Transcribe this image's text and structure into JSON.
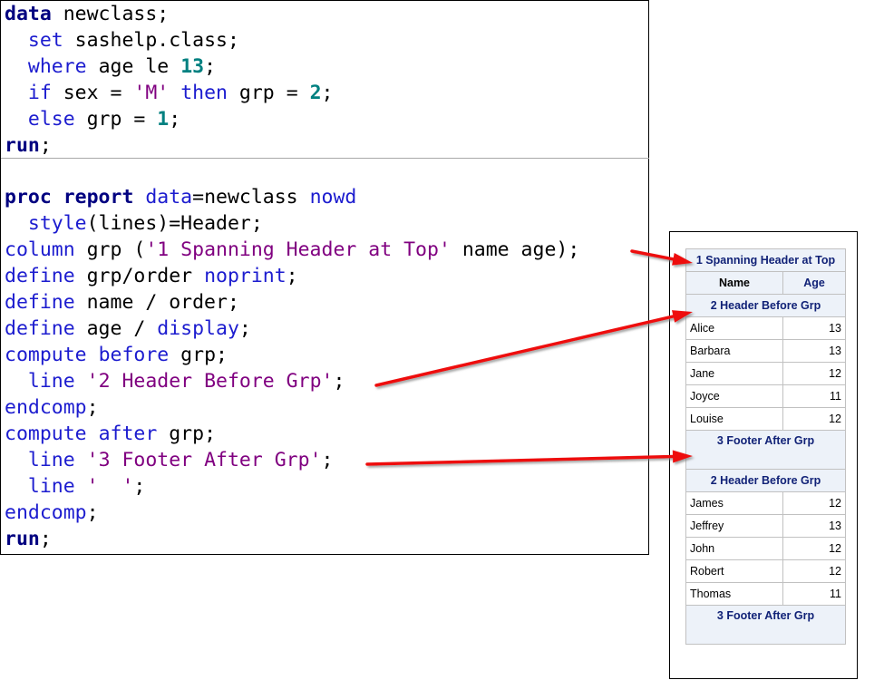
{
  "code": {
    "data_step": [
      [
        {
          "t": "data",
          "c": "kw-b"
        },
        {
          "t": " newclass;",
          "c": "plain"
        }
      ],
      [
        {
          "t": "  ",
          "c": "plain"
        },
        {
          "t": "set",
          "c": "kw-t"
        },
        {
          "t": " sashelp.class;",
          "c": "plain"
        }
      ],
      [
        {
          "t": "  ",
          "c": "plain"
        },
        {
          "t": "where",
          "c": "kw-t"
        },
        {
          "t": " age le ",
          "c": "plain"
        },
        {
          "t": "13",
          "c": "num"
        },
        {
          "t": ";",
          "c": "plain"
        }
      ],
      [
        {
          "t": "  ",
          "c": "plain"
        },
        {
          "t": "if",
          "c": "kw-t"
        },
        {
          "t": " sex = ",
          "c": "plain"
        },
        {
          "t": "'M'",
          "c": "str"
        },
        {
          "t": " ",
          "c": "plain"
        },
        {
          "t": "then",
          "c": "kw-t"
        },
        {
          "t": " grp = ",
          "c": "plain"
        },
        {
          "t": "2",
          "c": "num"
        },
        {
          "t": ";",
          "c": "plain"
        }
      ],
      [
        {
          "t": "  ",
          "c": "plain"
        },
        {
          "t": "else",
          "c": "kw-t"
        },
        {
          "t": " grp = ",
          "c": "plain"
        },
        {
          "t": "1",
          "c": "num"
        },
        {
          "t": ";",
          "c": "plain"
        }
      ],
      [
        {
          "t": "run",
          "c": "kw-b"
        },
        {
          "t": ";",
          "c": "plain"
        }
      ]
    ],
    "proc_step": [
      [
        {
          "t": "proc report",
          "c": "kw-b"
        },
        {
          "t": " ",
          "c": "plain"
        },
        {
          "t": "data",
          "c": "kw-t"
        },
        {
          "t": "=newclass ",
          "c": "plain"
        },
        {
          "t": "nowd",
          "c": "kw-t"
        }
      ],
      [
        {
          "t": "  ",
          "c": "plain"
        },
        {
          "t": "style",
          "c": "kw-t"
        },
        {
          "t": "(lines)=Header;",
          "c": "plain"
        }
      ],
      [
        {
          "t": "column",
          "c": "kw-t"
        },
        {
          "t": " grp (",
          "c": "plain"
        },
        {
          "t": "'1 Spanning Header at Top'",
          "c": "str"
        },
        {
          "t": " name age);",
          "c": "plain"
        }
      ],
      [
        {
          "t": "define",
          "c": "kw-t"
        },
        {
          "t": " grp/order ",
          "c": "plain"
        },
        {
          "t": "noprint",
          "c": "kw-t"
        },
        {
          "t": ";",
          "c": "plain"
        }
      ],
      [
        {
          "t": "define",
          "c": "kw-t"
        },
        {
          "t": " name / order;",
          "c": "plain"
        }
      ],
      [
        {
          "t": "define",
          "c": "kw-t"
        },
        {
          "t": " age / ",
          "c": "plain"
        },
        {
          "t": "display",
          "c": "kw-t"
        },
        {
          "t": ";",
          "c": "plain"
        }
      ],
      [
        {
          "t": "compute",
          "c": "kw-t"
        },
        {
          "t": " ",
          "c": "plain"
        },
        {
          "t": "before",
          "c": "kw-t"
        },
        {
          "t": " grp;",
          "c": "plain"
        }
      ],
      [
        {
          "t": "  ",
          "c": "plain"
        },
        {
          "t": "line",
          "c": "kw-t"
        },
        {
          "t": " ",
          "c": "plain"
        },
        {
          "t": "'2 Header Before Grp'",
          "c": "str"
        },
        {
          "t": ";",
          "c": "plain"
        }
      ],
      [
        {
          "t": "endcomp",
          "c": "kw-t"
        },
        {
          "t": ";",
          "c": "plain"
        }
      ],
      [
        {
          "t": "compute",
          "c": "kw-t"
        },
        {
          "t": " ",
          "c": "plain"
        },
        {
          "t": "after",
          "c": "kw-t"
        },
        {
          "t": " grp;",
          "c": "plain"
        }
      ],
      [
        {
          "t": "  ",
          "c": "plain"
        },
        {
          "t": "line",
          "c": "kw-t"
        },
        {
          "t": " ",
          "c": "plain"
        },
        {
          "t": "'3 Footer After Grp'",
          "c": "str"
        },
        {
          "t": ";",
          "c": "plain"
        }
      ],
      [
        {
          "t": "  ",
          "c": "plain"
        },
        {
          "t": "line",
          "c": "kw-t"
        },
        {
          "t": " ",
          "c": "plain"
        },
        {
          "t": "'  '",
          "c": "str"
        },
        {
          "t": ";",
          "c": "plain"
        }
      ],
      [
        {
          "t": "endcomp",
          "c": "kw-t"
        },
        {
          "t": ";",
          "c": "plain"
        }
      ],
      [
        {
          "t": "run",
          "c": "kw-b"
        },
        {
          "t": ";",
          "c": "plain"
        }
      ]
    ]
  },
  "report": {
    "spanning_header": "1 Spanning Header at Top",
    "columns": [
      "Name",
      "Age"
    ],
    "groups": [
      {
        "header": "2 Header Before Grp",
        "rows": [
          {
            "name": "Alice",
            "age": "13"
          },
          {
            "name": "Barbara",
            "age": "13"
          },
          {
            "name": "Jane",
            "age": "12"
          },
          {
            "name": "Joyce",
            "age": "11"
          },
          {
            "name": "Louise",
            "age": "12"
          }
        ],
        "footer": "3 Footer After Grp"
      },
      {
        "header": "2 Header Before Grp",
        "rows": [
          {
            "name": "James",
            "age": "12"
          },
          {
            "name": "Jeffrey",
            "age": "13"
          },
          {
            "name": "John",
            "age": "12"
          },
          {
            "name": "Robert",
            "age": "12"
          },
          {
            "name": "Thomas",
            "age": "11"
          }
        ],
        "footer": "3 Footer After Grp"
      }
    ]
  },
  "colors": {
    "arrow": "#ee1111",
    "header_bg": "#edf2f9",
    "header_text": "#112277",
    "keyword": "#1c1ccf",
    "string": "#800080",
    "number": "#008080"
  }
}
